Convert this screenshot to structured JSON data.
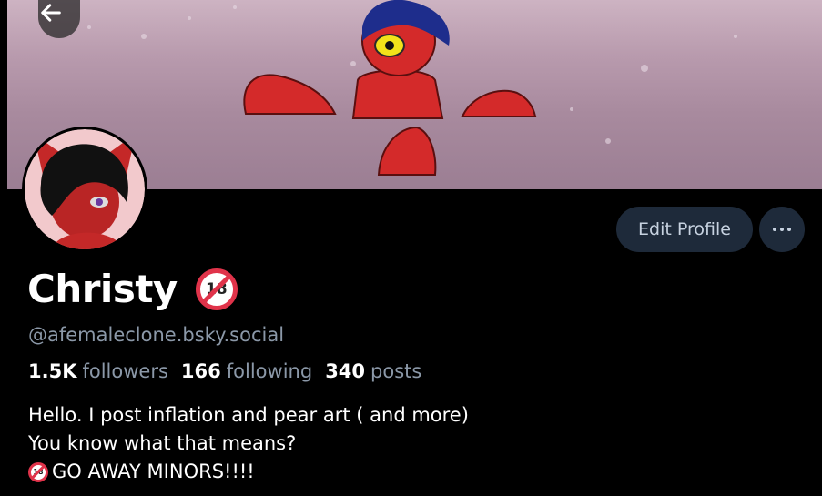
{
  "profile": {
    "display_name": "Christy",
    "handle": "@afemaleclone.bsky.social",
    "badge_text": "18",
    "stats": {
      "followers_count": "1.5K",
      "followers_label": "followers",
      "following_count": "166",
      "following_label": "following",
      "posts_count": "340",
      "posts_label": "posts"
    },
    "bio": {
      "line1": "Hello. I post inflation and pear art ( and more)",
      "line2": "You know what that means?",
      "line3": "GO AWAY MINORS!!!!"
    }
  },
  "actions": {
    "edit_profile_label": "Edit Profile",
    "more_icon": "ellipsis-icon",
    "back_icon": "arrow-left-icon"
  },
  "colors": {
    "button_bg": "#1e2a3a",
    "muted_text": "#8b98a8",
    "badge_red": "#e0334a",
    "character_red": "#d42a2a"
  }
}
